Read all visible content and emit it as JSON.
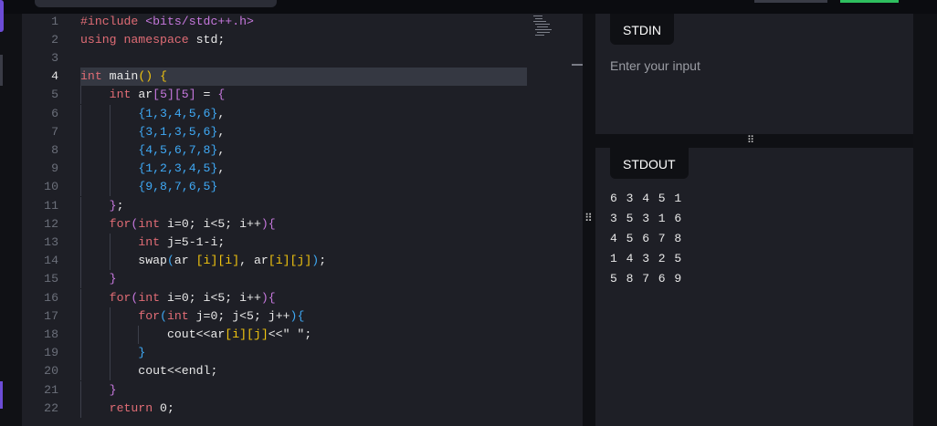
{
  "editor": {
    "current_line": 4,
    "lines": [
      {
        "n": "1",
        "segs": [
          {
            "c": "pp",
            "t": "#include "
          },
          {
            "c": "inc",
            "t": "<bits/stdc++.h>"
          }
        ]
      },
      {
        "n": "2",
        "segs": [
          {
            "c": "kw",
            "t": "using namespace "
          },
          {
            "c": "",
            "t": "std;"
          }
        ]
      },
      {
        "n": "3",
        "segs": []
      },
      {
        "n": "4",
        "segs": [
          {
            "c": "kw",
            "t": "int"
          },
          {
            "c": "",
            "t": " main"
          },
          {
            "c": "b1",
            "t": "()"
          },
          {
            "c": "",
            "t": " "
          },
          {
            "c": "b1",
            "t": "{"
          }
        ]
      },
      {
        "n": "5",
        "segs": [
          {
            "c": "",
            "t": "    "
          },
          {
            "c": "kw",
            "t": "int"
          },
          {
            "c": "",
            "t": " ar"
          },
          {
            "c": "b2",
            "t": "[5][5]"
          },
          {
            "c": "",
            "t": " = "
          },
          {
            "c": "b2",
            "t": "{"
          }
        ]
      },
      {
        "n": "6",
        "segs": [
          {
            "c": "",
            "t": "        "
          },
          {
            "c": "b3",
            "t": "{1,3,4,5,6}"
          },
          {
            "c": "",
            "t": ","
          }
        ]
      },
      {
        "n": "7",
        "segs": [
          {
            "c": "",
            "t": "        "
          },
          {
            "c": "b3",
            "t": "{3,1,3,5,6}"
          },
          {
            "c": "",
            "t": ","
          }
        ]
      },
      {
        "n": "8",
        "segs": [
          {
            "c": "",
            "t": "        "
          },
          {
            "c": "b3",
            "t": "{4,5,6,7,8}"
          },
          {
            "c": "",
            "t": ","
          }
        ]
      },
      {
        "n": "9",
        "segs": [
          {
            "c": "",
            "t": "        "
          },
          {
            "c": "b3",
            "t": "{1,2,3,4,5}"
          },
          {
            "c": "",
            "t": ","
          }
        ]
      },
      {
        "n": "10",
        "segs": [
          {
            "c": "",
            "t": "        "
          },
          {
            "c": "b3",
            "t": "{9,8,7,6,5}"
          }
        ]
      },
      {
        "n": "11",
        "segs": [
          {
            "c": "",
            "t": "    "
          },
          {
            "c": "b2",
            "t": "}"
          },
          {
            "c": "",
            "t": ";"
          }
        ]
      },
      {
        "n": "12",
        "segs": [
          {
            "c": "",
            "t": "    "
          },
          {
            "c": "kw",
            "t": "for"
          },
          {
            "c": "b2",
            "t": "("
          },
          {
            "c": "kw",
            "t": "int"
          },
          {
            "c": "",
            "t": " i=0; i<5; i++"
          },
          {
            "c": "b2",
            "t": "){"
          }
        ]
      },
      {
        "n": "13",
        "segs": [
          {
            "c": "",
            "t": "        "
          },
          {
            "c": "kw",
            "t": "int"
          },
          {
            "c": "",
            "t": " j=5-1-i;"
          }
        ]
      },
      {
        "n": "14",
        "segs": [
          {
            "c": "",
            "t": "        swap"
          },
          {
            "c": "b3",
            "t": "("
          },
          {
            "c": "",
            "t": "ar "
          },
          {
            "c": "b1",
            "t": "[i][i]"
          },
          {
            "c": "",
            "t": ", ar"
          },
          {
            "c": "b1",
            "t": "[i][j]"
          },
          {
            "c": "b3",
            "t": ")"
          },
          {
            "c": "",
            "t": ";"
          }
        ]
      },
      {
        "n": "15",
        "segs": [
          {
            "c": "",
            "t": "    "
          },
          {
            "c": "b2",
            "t": "}"
          }
        ]
      },
      {
        "n": "16",
        "segs": [
          {
            "c": "",
            "t": "    "
          },
          {
            "c": "kw",
            "t": "for"
          },
          {
            "c": "b2",
            "t": "("
          },
          {
            "c": "kw",
            "t": "int"
          },
          {
            "c": "",
            "t": " i=0; i<5; i++"
          },
          {
            "c": "b2",
            "t": "){"
          }
        ]
      },
      {
        "n": "17",
        "segs": [
          {
            "c": "",
            "t": "        "
          },
          {
            "c": "kw",
            "t": "for"
          },
          {
            "c": "b3",
            "t": "("
          },
          {
            "c": "kw",
            "t": "int"
          },
          {
            "c": "",
            "t": " j=0; j<5; j++"
          },
          {
            "c": "b3",
            "t": "){"
          }
        ]
      },
      {
        "n": "18",
        "segs": [
          {
            "c": "",
            "t": "            cout<<ar"
          },
          {
            "c": "b1",
            "t": "[i][j]"
          },
          {
            "c": "",
            "t": "<<\" \";"
          }
        ]
      },
      {
        "n": "19",
        "segs": [
          {
            "c": "",
            "t": "        "
          },
          {
            "c": "b3",
            "t": "}"
          }
        ]
      },
      {
        "n": "20",
        "segs": [
          {
            "c": "",
            "t": "        cout<<endl;"
          }
        ]
      },
      {
        "n": "21",
        "segs": [
          {
            "c": "",
            "t": "    "
          },
          {
            "c": "b2",
            "t": "}"
          }
        ]
      },
      {
        "n": "22",
        "segs": [
          {
            "c": "",
            "t": "    "
          },
          {
            "c": "kw",
            "t": "return"
          },
          {
            "c": "",
            "t": " 0;"
          }
        ]
      }
    ]
  },
  "stdin": {
    "tab_label": "STDIN",
    "placeholder": "Enter your input"
  },
  "stdout": {
    "tab_label": "STDOUT",
    "lines": [
      "6 3 4 5 1",
      "3 5 3 1 6",
      "4 5 6 7 8",
      "1 4 3 2 5",
      "5 8 7 6 9"
    ]
  },
  "icons": {
    "vertical_grip": "drag-handle-icon",
    "horizontal_grip": "drag-handle-icon"
  },
  "colors": {
    "keyword": "#e06c75",
    "include": "#c678dd",
    "bracket_1": "#f1c40f",
    "bracket_2": "#c678dd",
    "bracket_3": "#3fa9f5",
    "editor_bg": "#1e1f26",
    "accent_green": "#2fbf5f"
  }
}
